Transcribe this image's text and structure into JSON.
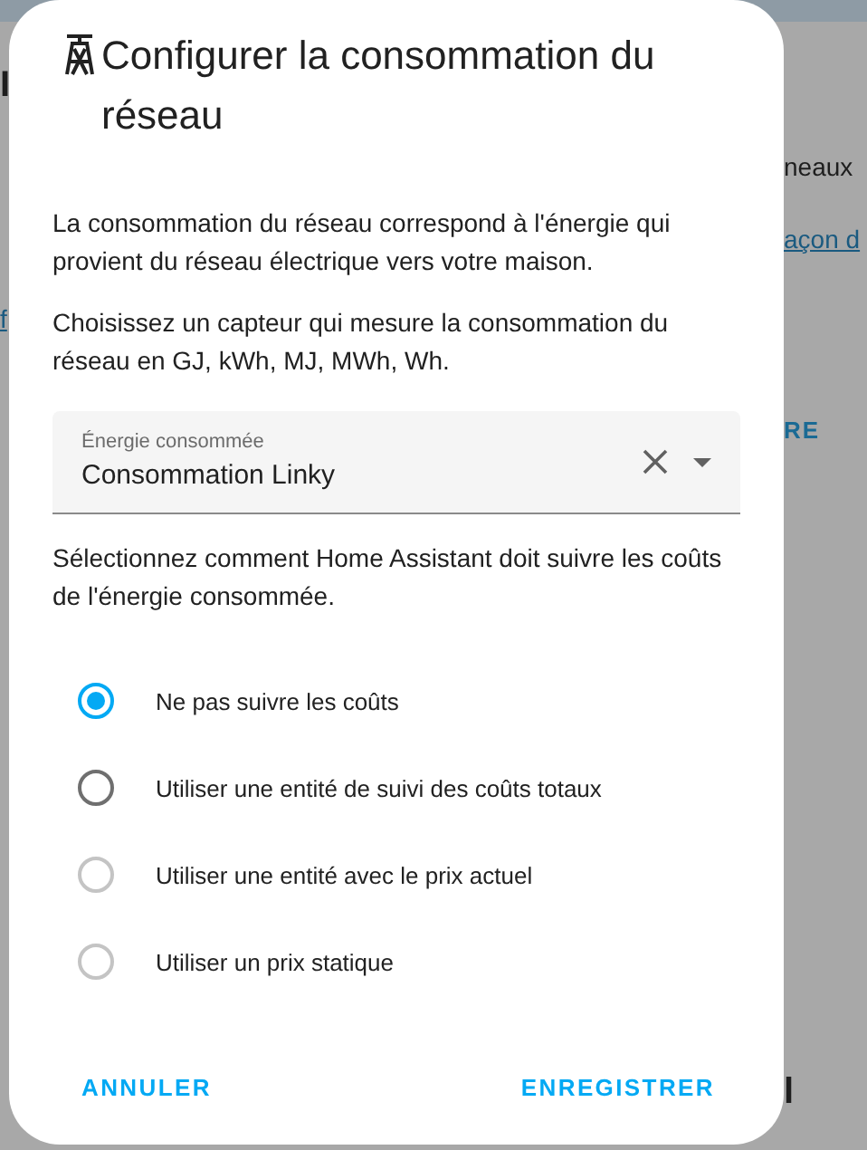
{
  "background": {
    "left": [
      {
        "kind": "heading",
        "text": "I"
      },
      {
        "kind": "link",
        "text": "f"
      }
    ],
    "right": [
      {
        "kind": "text",
        "text": "neaux"
      },
      {
        "kind": "link",
        "text": "açon d"
      },
      {
        "kind": "action",
        "text": "RE"
      },
      {
        "kind": "heading",
        "text": "l"
      }
    ]
  },
  "dialog": {
    "title": "Configurer la consommation du réseau",
    "paragraphs": [
      "La consommation du réseau correspond à l'énergie qui provient du réseau électrique vers votre maison.",
      "Choisissez un capteur qui mesure la consommation du réseau en GJ, kWh, MJ, MWh, Wh."
    ],
    "field": {
      "label": "Énergie consommée",
      "value": "Consommation Linky"
    },
    "cost_prompt": "Sélectionnez comment Home Assistant doit suivre les coûts de l'énergie consommée.",
    "options": [
      {
        "label": "Ne pas suivre les coûts",
        "selected": true,
        "disabled": false
      },
      {
        "label": "Utiliser une entité de suivi des coûts totaux",
        "selected": false,
        "disabled": false
      },
      {
        "label": "Utiliser une entité avec le prix actuel",
        "selected": false,
        "disabled": true
      },
      {
        "label": "Utiliser un prix statique",
        "selected": false,
        "disabled": true
      }
    ],
    "buttons": [
      {
        "label": "ANNULER",
        "kind": "cancel"
      },
      {
        "label": "ENREGISTRER",
        "kind": "save"
      }
    ]
  }
}
